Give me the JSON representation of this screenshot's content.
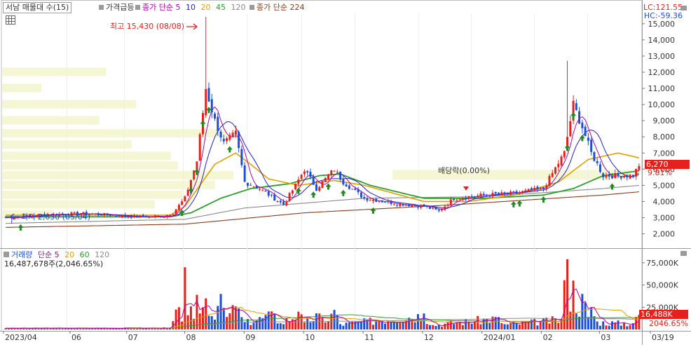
{
  "legend": {
    "stock_name": "서남 매물대 수(15)",
    "price_surge": "가격급등",
    "ma_label": "종가 단순",
    "ma_periods": [
      "5",
      "10",
      "20",
      "45",
      "120"
    ],
    "ma224_label": "종가 단순 224"
  },
  "corner": {
    "lc": "LC:121.55",
    "hc": "HC:-59.36"
  },
  "annotations": {
    "high": "최고 15,430 (08/08)",
    "low": "최저 2,630 (05/04)",
    "dividend": "배당락(0.00%)"
  },
  "current": {
    "price": "6,270",
    "change": "9.81%"
  },
  "volume_legend": {
    "label": "거래량",
    "ma_label": "단순",
    "periods": [
      "5",
      "20",
      "60",
      "120"
    ],
    "value_text": "16,487,678주(2,046.65%)"
  },
  "volume_current": {
    "value": "16,488K",
    "pct": "2046.65%"
  },
  "colors": {
    "up": "#e8201b",
    "down": "#1c4fd8",
    "ma5": "#b000b0",
    "ma10": "#2020d0",
    "ma20": "#e0a000",
    "ma45": "#2aa12a",
    "ma120": "#8a8a8a",
    "ma224": "#8b3a1a",
    "volume_profile": "#f5f7d4",
    "arrow": "#1f8a1f"
  },
  "chart_data": [
    {
      "type": "candlestick",
      "title": "서남",
      "x_tick_labels": [
        "2023/04",
        "06",
        "07",
        "08",
        "09",
        "10",
        "11",
        "12",
        "2024/01",
        "02",
        "03",
        "03/19"
      ],
      "y_ticks": [
        2000,
        3000,
        4000,
        5000,
        6000,
        7000,
        8000,
        9000,
        10000,
        11000,
        12000,
        13000,
        14000,
        15000
      ],
      "y_tick_labels": [
        "2,000",
        "3,000",
        "4,000",
        "5,000",
        "6,000",
        "7,000",
        "8,000",
        "9,000",
        "10,000",
        "11,000",
        "12,000",
        "13,000",
        "14,000",
        "15,000"
      ],
      "ylim": [
        1200,
        15600
      ],
      "period_high": 15430,
      "period_low": 2630,
      "last_close": 6270,
      "last_change_pct": 9.81,
      "series_keypoints": {
        "close": [
          [
            0,
            3000
          ],
          [
            14,
            3200
          ],
          [
            25,
            3250
          ],
          [
            32,
            3200
          ],
          [
            44,
            3050
          ],
          [
            53,
            3100
          ],
          [
            56,
            3300
          ],
          [
            60,
            4200
          ],
          [
            64,
            6500
          ],
          [
            67,
            11000
          ],
          [
            70,
            9000
          ],
          [
            73,
            7600
          ],
          [
            77,
            8200
          ],
          [
            80,
            5200
          ],
          [
            85,
            4800
          ],
          [
            93,
            3800
          ],
          [
            97,
            5000
          ],
          [
            100,
            6000
          ],
          [
            104,
            4800
          ],
          [
            110,
            6000
          ],
          [
            113,
            5200
          ],
          [
            120,
            4200
          ],
          [
            130,
            3900
          ],
          [
            140,
            3700
          ],
          [
            145,
            3400
          ],
          [
            150,
            4200
          ],
          [
            160,
            4400
          ],
          [
            170,
            4500
          ],
          [
            180,
            4800
          ],
          [
            187,
            7000
          ],
          [
            190,
            10000
          ],
          [
            193,
            8600
          ],
          [
            196,
            7000
          ],
          [
            200,
            5600
          ],
          [
            210,
            5600
          ],
          [
            212,
            6270
          ]
        ],
        "ma20": [
          [
            0,
            3150
          ],
          [
            55,
            3150
          ],
          [
            60,
            3700
          ],
          [
            70,
            6300
          ],
          [
            77,
            7000
          ],
          [
            82,
            6300
          ],
          [
            88,
            5400
          ],
          [
            98,
            5000
          ],
          [
            110,
            5300
          ],
          [
            120,
            5000
          ],
          [
            140,
            4000
          ],
          [
            155,
            4000
          ],
          [
            170,
            4400
          ],
          [
            185,
            5200
          ],
          [
            195,
            6600
          ],
          [
            205,
            7000
          ],
          [
            212,
            6700
          ]
        ],
        "ma45": [
          [
            0,
            3050
          ],
          [
            55,
            3050
          ],
          [
            62,
            3300
          ],
          [
            72,
            4200
          ],
          [
            82,
            4800
          ],
          [
            95,
            5100
          ],
          [
            105,
            5600
          ],
          [
            112,
            5700
          ],
          [
            122,
            5000
          ],
          [
            140,
            4200
          ],
          [
            160,
            4200
          ],
          [
            180,
            4400
          ],
          [
            190,
            4800
          ],
          [
            200,
            5600
          ],
          [
            212,
            5900
          ]
        ],
        "ma120": [
          [
            0,
            2650
          ],
          [
            60,
            2900
          ],
          [
            80,
            3600
          ],
          [
            120,
            4200
          ],
          [
            160,
            4300
          ],
          [
            200,
            4800
          ],
          [
            212,
            5000
          ]
        ],
        "ma224": [
          [
            0,
            2400
          ],
          [
            60,
            2600
          ],
          [
            100,
            3300
          ],
          [
            150,
            3800
          ],
          [
            200,
            4400
          ],
          [
            212,
            4600
          ]
        ]
      },
      "volume_profile_rows": [
        {
          "price": 12000,
          "weight": 0.45
        },
        {
          "price": 11000,
          "weight": 0.17
        },
        {
          "price": 10000,
          "weight": 0.58
        },
        {
          "price": 9000,
          "weight": 0.42
        },
        {
          "price": 8200,
          "weight": 0.97
        },
        {
          "price": 7500,
          "weight": 0.56
        },
        {
          "price": 6800,
          "weight": 0.73
        },
        {
          "price": 6200,
          "weight": 0.76
        },
        {
          "price": 5600,
          "weight": 1.0
        },
        {
          "price": 5000,
          "weight": 0.92
        },
        {
          "price": 4400,
          "weight": 0.78
        },
        {
          "price": 3800,
          "weight": 0.66
        },
        {
          "price": 3200,
          "weight": 0.22
        }
      ]
    },
    {
      "type": "bar",
      "title": "거래량",
      "y_ticks": [
        25000,
        50000,
        75000
      ],
      "y_tick_labels": [
        "25,000K",
        "50,000K",
        "75,000K"
      ],
      "ylim": [
        0,
        82000
      ],
      "unit": "K",
      "last_value_k": 16488,
      "spikes": [
        [
          58,
          25000
        ],
        [
          60,
          70000
        ],
        [
          62,
          26000
        ],
        [
          64,
          39000
        ],
        [
          67,
          35000
        ],
        [
          72,
          40000
        ],
        [
          77,
          26000
        ],
        [
          90,
          18000
        ],
        [
          98,
          20000
        ],
        [
          105,
          18000
        ],
        [
          110,
          22000
        ],
        [
          140,
          18000
        ],
        [
          165,
          14000
        ],
        [
          188,
          79000
        ],
        [
          190,
          55000
        ],
        [
          193,
          40000
        ],
        [
          196,
          25000
        ],
        [
          212,
          16488
        ]
      ]
    }
  ]
}
